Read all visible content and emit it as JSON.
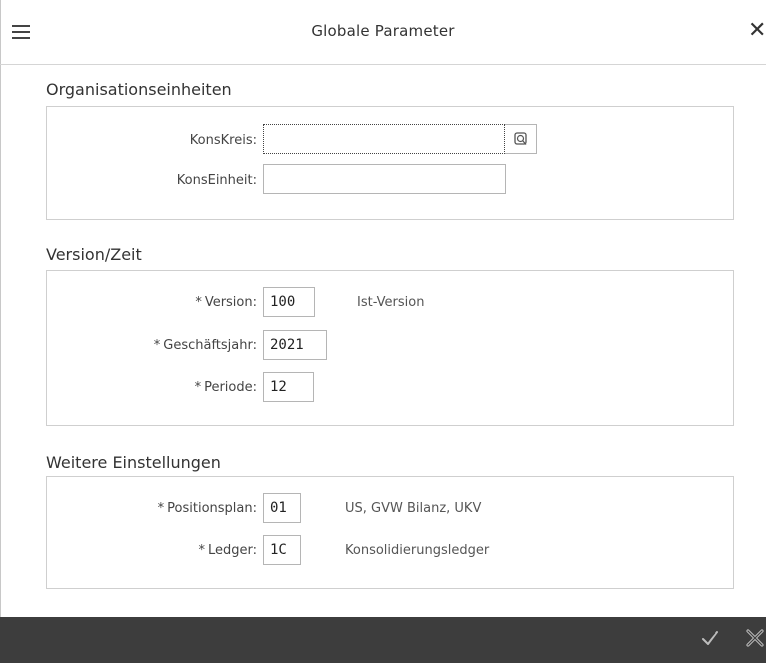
{
  "header": {
    "title": "Globale Parameter"
  },
  "sections": {
    "org": {
      "title": "Organisationseinheiten",
      "konskreis_label": "KonsKreis:",
      "konskreis_value": "",
      "konseinheit_label": "KonsEinheit:",
      "konseinheit_value": ""
    },
    "version": {
      "title": "Version/Zeit",
      "version_label": "Version:",
      "version_value": "100",
      "version_desc": "Ist-Version",
      "jahr_label": "Geschäftsjahr:",
      "jahr_value": "2021",
      "periode_label": "Periode:",
      "periode_value": "12"
    },
    "weitere": {
      "title": "Weitere Einstellungen",
      "positionsplan_label": "Positionsplan:",
      "positionsplan_value": "01",
      "positionsplan_desc": "US, GVW Bilanz, UKV",
      "ledger_label": "Ledger:",
      "ledger_value": "1C",
      "ledger_desc": "Konsolidierungsledger"
    }
  },
  "required_marker": "*",
  "icons": {
    "menu": "hamburger-menu-icon",
    "close": "close-icon",
    "value_help": "value-help-icon",
    "ok": "checkmark-icon",
    "cancel": "cancel-icon"
  }
}
